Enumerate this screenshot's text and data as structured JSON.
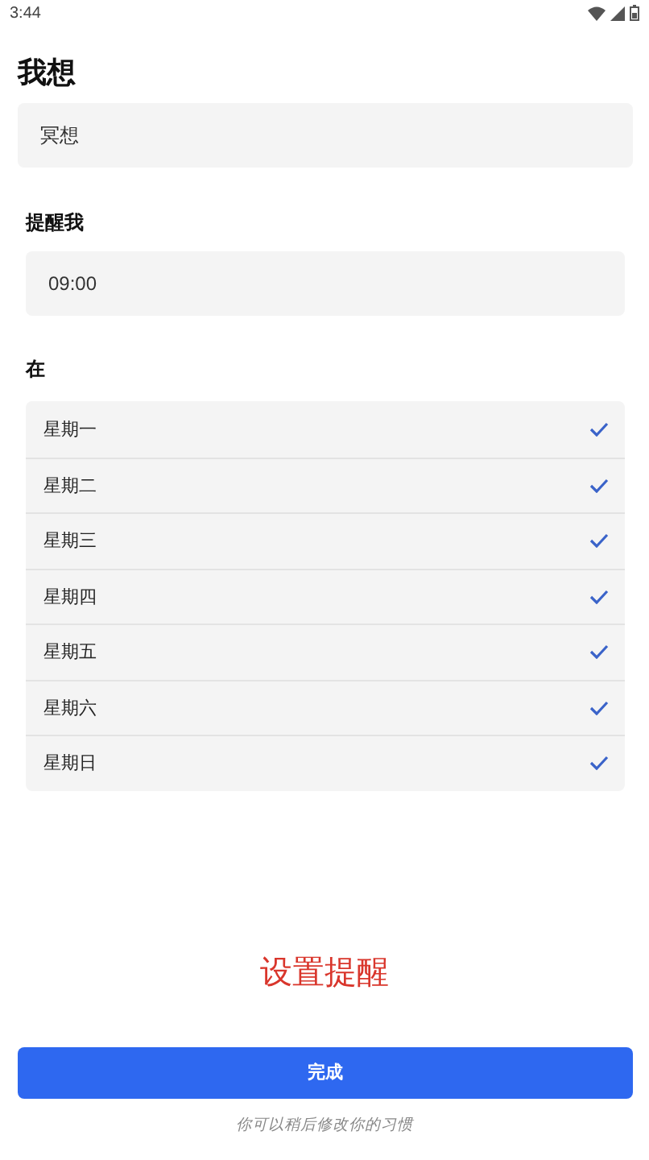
{
  "status_bar": {
    "time": "3:44"
  },
  "habit": {
    "label": "我想",
    "value": "冥想"
  },
  "reminder": {
    "label": "提醒我",
    "time": "09:00"
  },
  "days": {
    "label": "在",
    "items": [
      {
        "name": "星期一",
        "checked": true
      },
      {
        "name": "星期二",
        "checked": true
      },
      {
        "name": "星期三",
        "checked": true
      },
      {
        "name": "星期四",
        "checked": true
      },
      {
        "name": "星期五",
        "checked": true
      },
      {
        "name": "星期六",
        "checked": true
      },
      {
        "name": "星期日",
        "checked": true
      }
    ]
  },
  "set_reminder": "设置提醒",
  "done_button": "完成",
  "footnote": "你可以稍后修改你的习惯"
}
